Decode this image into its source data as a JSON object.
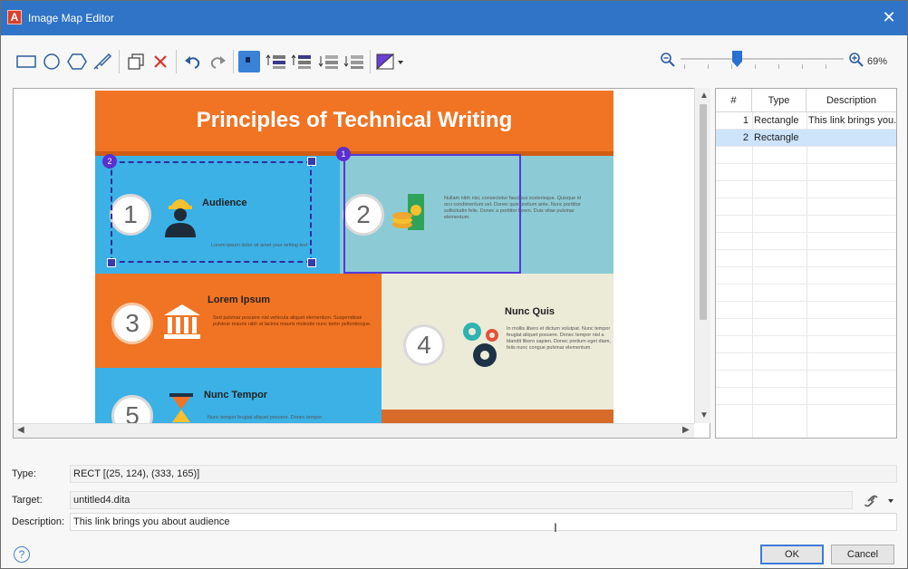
{
  "window": {
    "title": "Image Map Editor"
  },
  "toolbar": {
    "icons": [
      "rectangle-tool-icon",
      "circle-tool-icon",
      "polygon-tool-icon",
      "pen-tool-icon",
      "duplicate-icon",
      "delete-icon",
      "undo-icon",
      "redo-icon",
      "select-area-icon",
      "bring-forward-icon",
      "bring-to-front-icon",
      "send-backward-icon",
      "send-to-back-icon",
      "area-color-icon"
    ],
    "zoom": {
      "value": 69,
      "label": "69%"
    }
  },
  "infographic": {
    "title": "Principles of Technical Writing",
    "panels": [
      {
        "number": "1",
        "title": "Audience",
        "text": "Lorem ipsum dolor sit amet your writing text"
      },
      {
        "number": "2",
        "title": "",
        "text": "Nullam nibh nisi, consectetur faucibus scelerisque. Quisque id orci condimentum vel. Donec quis pretium ante. Nunc porttitor sollicitudin felis. Donec a porttitor lorem. Duis vitae pulvinar elementum."
      },
      {
        "number": "3",
        "title": "Lorem Ipsum",
        "text": "Sed pulvinar posuere nisl vehicula aliquet elementum. Suspendisse pulvinar mauris nibh at lacinia mauris molestie nunc tortor pellentesque."
      },
      {
        "number": "4",
        "title": "Nunc Quis",
        "text": "In mollis libero et dictum volutpat. Nunc tempor feugiat aliquet posuere. Donec tempor nisl a blandit libero sapien. Donec pretium eget diam, felis nunc congue pulvinar elementum."
      },
      {
        "number": "5",
        "title": "Nunc Tempor",
        "text": "Nunc tempor feugiat aliquet posuere. Donec tempor"
      }
    ],
    "badges": [
      "2",
      "1"
    ]
  },
  "table": {
    "headers": [
      "#",
      "Type",
      "Description"
    ],
    "rows": [
      {
        "num": "1",
        "type": "Rectangle",
        "description": "This link brings you..."
      },
      {
        "num": "2",
        "type": "Rectangle",
        "description": ""
      }
    ]
  },
  "properties": {
    "type_label": "Type:",
    "type_value": "RECT [(25, 124), (333, 165)]",
    "target_label": "Target:",
    "target_value": "untitled4.dita",
    "description_label": "Description:",
    "description_value": "This link brings you about audience"
  },
  "buttons": {
    "ok": "OK",
    "cancel": "Cancel"
  },
  "help": "?"
}
